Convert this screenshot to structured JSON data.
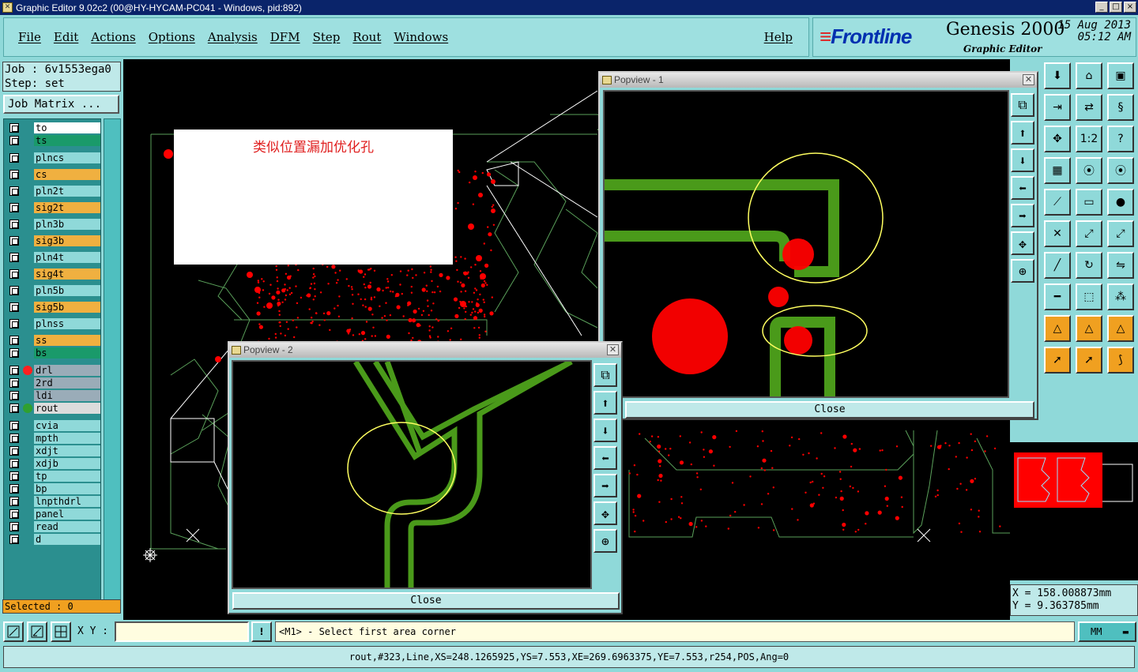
{
  "window": {
    "title": "Graphic Editor 9.02c2 (00@HY-HYCAM-PC041 - Windows, pid:892)",
    "controls": [
      "_",
      "□",
      "×"
    ]
  },
  "menu": {
    "items": [
      "File",
      "Edit",
      "Actions",
      "Options",
      "Analysis",
      "DFM",
      "Step",
      "Rout",
      "Windows"
    ],
    "help": "Help"
  },
  "brand": {
    "logo": "Frontline",
    "product": "Genesis 2000",
    "subtitle": "Graphic Editor",
    "date": "15 Aug 2013",
    "time": "05:12 AM"
  },
  "job": {
    "job_line": "Job : 6v1553ega0",
    "step_line": "Step: set",
    "matrix_button": "Job Matrix ..."
  },
  "layers": [
    {
      "name": "to",
      "color": "#ffffff"
    },
    {
      "name": "ts",
      "color": "#1a9a6a"
    },
    {
      "name": "plncs",
      "color": "#8fd9d9"
    },
    {
      "name": "cs",
      "color": "#f0b040"
    },
    {
      "name": "pln2t",
      "color": "#8fd9d9"
    },
    {
      "name": "sig2t",
      "color": "#f0b040"
    },
    {
      "name": "pln3b",
      "color": "#8fd9d9"
    },
    {
      "name": "sig3b",
      "color": "#f0b040"
    },
    {
      "name": "pln4t",
      "color": "#8fd9d9"
    },
    {
      "name": "sig4t",
      "color": "#f0b040"
    },
    {
      "name": "pln5b",
      "color": "#8fd9d9"
    },
    {
      "name": "sig5b",
      "color": "#f0b040"
    },
    {
      "name": "plnss",
      "color": "#8fd9d9"
    },
    {
      "name": "ss",
      "color": "#f0b040"
    },
    {
      "name": "bs",
      "color": "#1a9a6a"
    },
    {
      "name": "drl",
      "color": "#9aacb8"
    },
    {
      "name": "2rd",
      "color": "#9aacb8"
    },
    {
      "name": "ldi",
      "color": "#9aacb8"
    },
    {
      "name": "rout",
      "color": "#dcdcdc"
    },
    {
      "name": "cvia",
      "color": "#8fd9d9"
    },
    {
      "name": "mpth",
      "color": "#8fd9d9"
    },
    {
      "name": "xdjt",
      "color": "#8fd9d9"
    },
    {
      "name": "xdjb",
      "color": "#8fd9d9"
    },
    {
      "name": "tp",
      "color": "#8fd9d9"
    },
    {
      "name": "bp",
      "color": "#8fd9d9"
    },
    {
      "name": "lnpthdrl",
      "color": "#8fd9d9"
    },
    {
      "name": "panel",
      "color": "#8fd9d9"
    },
    {
      "name": "read",
      "color": "#8fd9d9"
    },
    {
      "name": "d",
      "color": "#8fd9d9"
    }
  ],
  "selected_text": "Selected : 0",
  "annotation": "类似位置漏加优化孔",
  "popview1": {
    "title": "Popview - 1",
    "close_label": "Close"
  },
  "popview2": {
    "title": "Popview - 2",
    "close_label": "Close"
  },
  "coords": {
    "x": "X  =  158.008873mm",
    "y": "Y  =  9.363785mm"
  },
  "bottom": {
    "xy_label": "X Y :",
    "xy_value": "",
    "alert": "!",
    "message": "<M1> - Select first area corner",
    "units": "MM"
  },
  "status_line": "rout,#323,Line,XS=248.1265925,YS=7.553,XE=269.6963375,YE=7.553,r254,POS,Ang=0",
  "colors": {
    "accent": "#8fd9d9",
    "trace": "#4a9a1a",
    "pad": "#ff0000",
    "highlight": "#ffff60",
    "outline": "#5aa05a"
  }
}
